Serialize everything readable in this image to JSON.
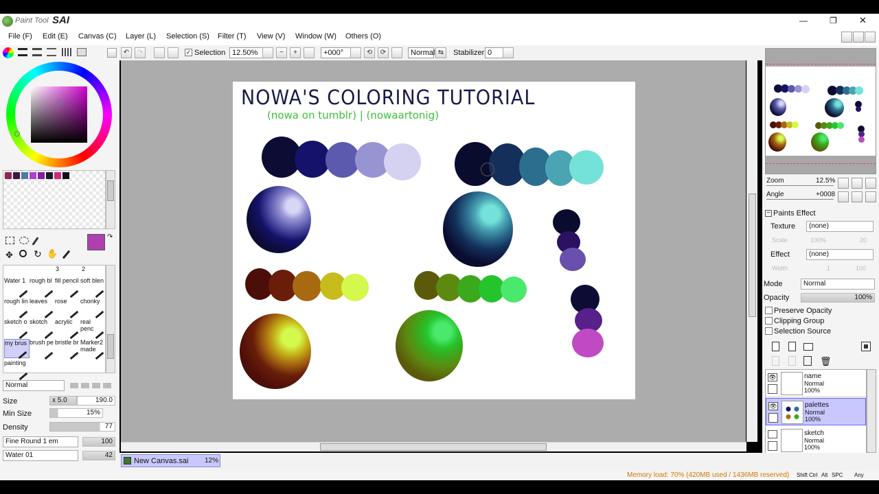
{
  "app": {
    "logo_text": "Paint Tool",
    "logo_brand": "SAI",
    "win_min": "—",
    "win_max": "❐",
    "win_close": "✕"
  },
  "menu": [
    "File (F)",
    "Edit (E)",
    "Canvas (C)",
    "Layer (L)",
    "Selection (S)",
    "Filter (T)",
    "View (V)",
    "Window (W)",
    "Others (O)"
  ],
  "toolbar": {
    "selection_label": "Selection",
    "zoom": "12.50%",
    "angle": "+000°",
    "blend": "Normal",
    "stabilizer_label": "Stabilizer",
    "stabilizer_value": "0"
  },
  "canvas": {
    "title": "NOWA'S COLORING TUTORIAL",
    "subtitle": "(nowa on tumblr) | (nowaartonig)"
  },
  "brush_tools": [
    {
      "name": "Water 1",
      "row": 0
    },
    {
      "name": "rough bl",
      "row": 0
    },
    {
      "name": "fill pencil",
      "row": 0
    },
    {
      "name": "soft blen",
      "row": 0
    },
    {
      "name": "rough lin",
      "row": 1
    },
    {
      "name": "leaves",
      "row": 1
    },
    {
      "name": "rose",
      "row": 1
    },
    {
      "name": "chonky",
      "row": 1
    },
    {
      "name": "sketch o",
      "row": 2
    },
    {
      "name": "skotch",
      "row": 2
    },
    {
      "name": "acrylic",
      "row": 2
    },
    {
      "name": "real penc",
      "row": 2
    },
    {
      "name": "my brus",
      "row": 3
    },
    {
      "name": "brush pe",
      "row": 3
    },
    {
      "name": "bristle br",
      "row": 3
    },
    {
      "name": "Marker2 made",
      "row": 3
    },
    {
      "name": "painting",
      "row": 4
    }
  ],
  "brush_numbers": {
    "n3": "3",
    "n2": "2"
  },
  "brush_settings": {
    "mode": "Normal",
    "size_label": "Size",
    "size_mult": "x 5.0",
    "size_value": "190.0",
    "min_size_label": "Min Size",
    "min_size_value": "15%",
    "density_label": "Density",
    "density_value": "77",
    "shape": "Fine Round 1 em",
    "shape_value": "100",
    "texture": "Water 01",
    "texture_value": "42"
  },
  "navigator": {
    "zoom_label": "Zoom",
    "zoom_value": "12.5%",
    "angle_label": "Angle",
    "angle_value": "+0008"
  },
  "paints_effect": {
    "header": "Paints Effect",
    "texture_label": "Texture",
    "texture_value": "(none)",
    "scale_label": "Scale",
    "scale_value": "100%",
    "scale_num": "20",
    "effect_label": "Effect",
    "effect_value": "(none)",
    "width_label": "Width",
    "width_value": "1",
    "width_num": "100"
  },
  "layer_props": {
    "mode_label": "Mode",
    "mode_value": "Normal",
    "opacity_label": "Opacity",
    "opacity_value": "100%",
    "preserve_opacity": "Preserve Opacity",
    "clipping_group": "Clipping Group",
    "selection_source": "Selection Source"
  },
  "layers": [
    {
      "name": "name",
      "mode": "Normal",
      "opacity": "100%"
    },
    {
      "name": "palettes",
      "mode": "Normal",
      "opacity": "100%"
    },
    {
      "name": "sketch",
      "mode": "Normal",
      "opacity": "100%"
    }
  ],
  "tab": {
    "name": "New Canvas.sai",
    "zoom": "12%"
  },
  "status": {
    "memory": "Memory load: 70% (420MB used / 1436MB reserved)",
    "keys": [
      "Shift",
      "Ctrl",
      "Alt",
      "SPC",
      "Any"
    ]
  },
  "colors": {
    "accent": "#b040b0",
    "memory_text": "#d07800",
    "selected_layer": "#c8c8ff"
  }
}
